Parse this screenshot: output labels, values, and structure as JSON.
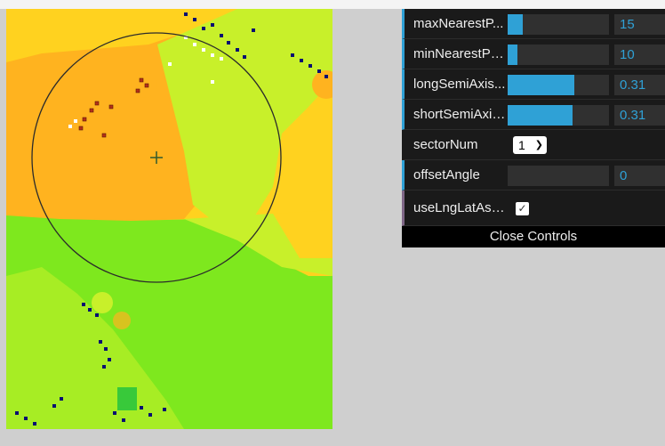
{
  "controls": {
    "max_nearest": {
      "label": "maxNearestP...",
      "value": "15",
      "fraction": 0.15
    },
    "min_nearest": {
      "label": "minNearestPo...",
      "value": "10",
      "fraction": 0.1
    },
    "long_semi_axis": {
      "label": "longSemiAxis...",
      "value": "0.31",
      "fraction": 0.66
    },
    "short_semi_axis": {
      "label": "shortSemiAxis...",
      "value": "0.31",
      "fraction": 0.64
    },
    "sector_num": {
      "label": "sectorNum",
      "value": "1"
    },
    "offset_angle": {
      "label": "offsetAngle",
      "value": "0",
      "fraction": 0.0
    },
    "use_lnglat": {
      "label": "useLngLatAsXY",
      "checked": true
    }
  },
  "close_controls_label": "Close Controls",
  "colors": {
    "accent": "#2fa1d6",
    "panel_bg": "#1a1a1a",
    "map_yellow": "#ffd21f",
    "map_orange": "#ffb31f",
    "map_lime": "#c8f02a",
    "map_green": "#7ee81e"
  },
  "icons": {
    "dropdown": "chevron-down-icon",
    "checkbox": "check-icon",
    "center": "crosshair-icon"
  }
}
